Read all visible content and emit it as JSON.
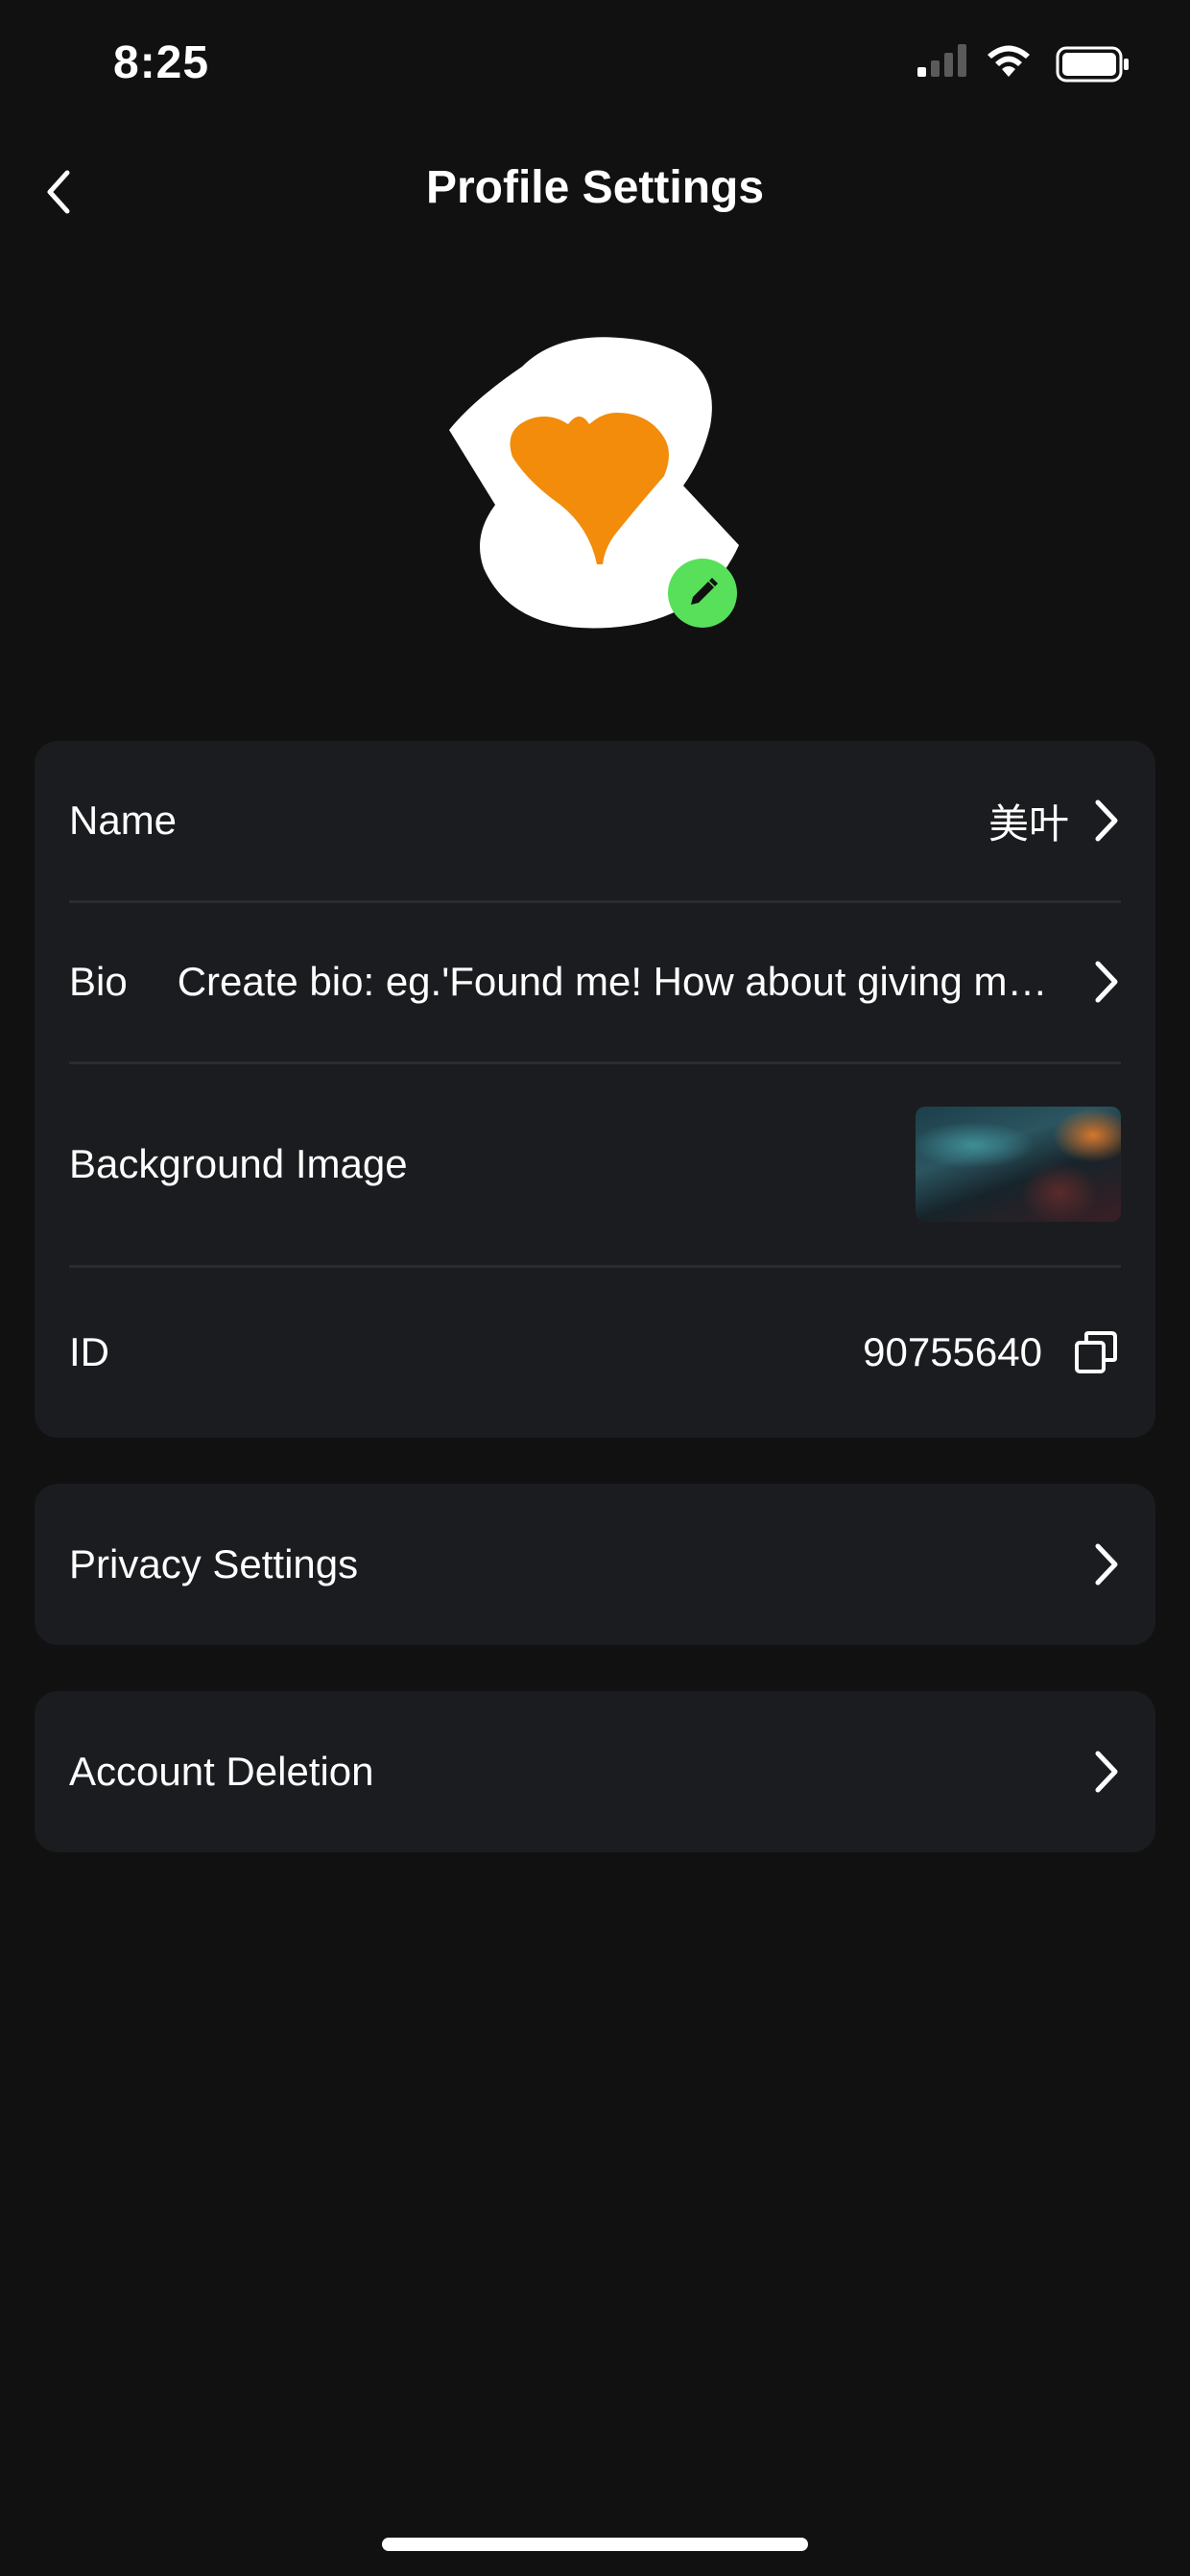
{
  "status_bar": {
    "time": "8:25",
    "icons": [
      "signal-icon",
      "wifi-icon",
      "battery-icon"
    ]
  },
  "header": {
    "title": "Profile Settings",
    "back_icon": "chevron-left-icon"
  },
  "avatar": {
    "edit_icon": "pencil-icon",
    "badge_color": "#58e05a",
    "leaf_color": "#f28c0a"
  },
  "profile_card": {
    "name_label": "Name",
    "name_value": "美叶",
    "bio_label": "Bio",
    "bio_value": "Create bio: eg.'Found me! How about giving me a follow?'",
    "background_label": "Background Image",
    "id_label": "ID",
    "id_value": "90755640",
    "copy_icon": "copy-icon"
  },
  "privacy_settings": {
    "label": "Privacy Settings"
  },
  "account_deletion": {
    "label": "Account Deletion"
  },
  "colors": {
    "background": "#111111",
    "card": "#1b1c1f",
    "divider": "#2b2c30",
    "text": "#ffffff"
  }
}
